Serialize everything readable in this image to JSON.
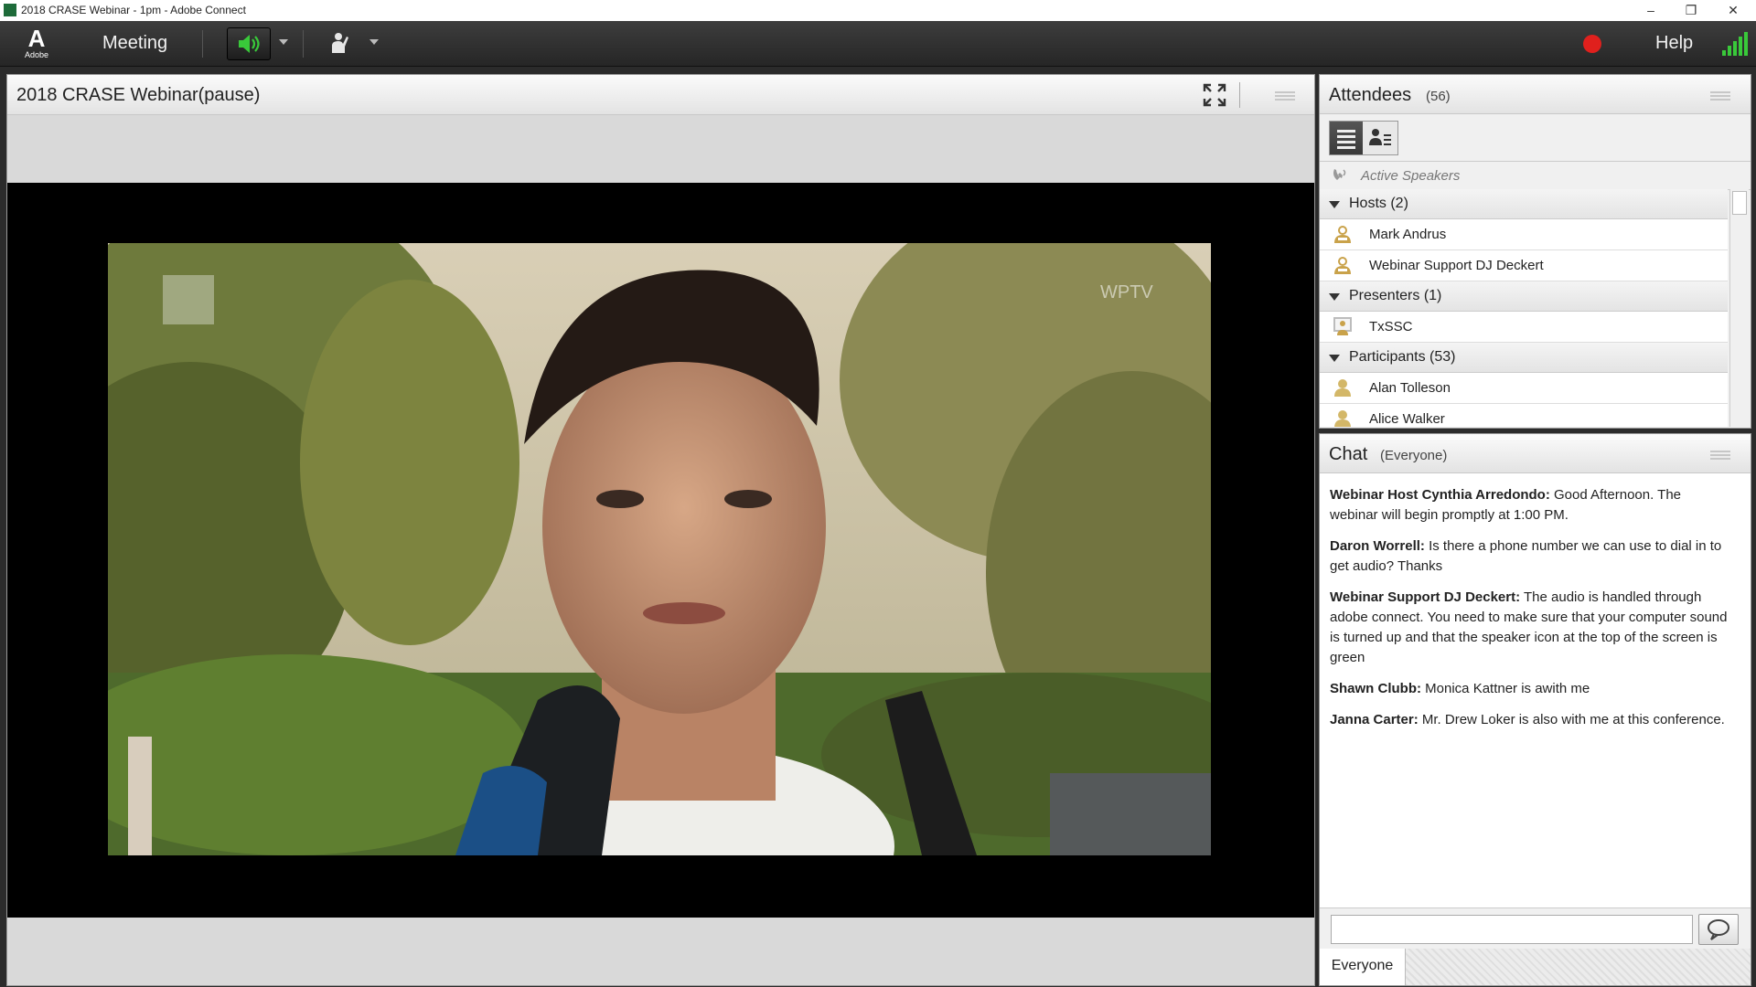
{
  "window": {
    "title": "2018 CRASE Webinar - 1pm - Adobe Connect",
    "min_glyph": "–",
    "restore_glyph": "❐",
    "close_glyph": "✕"
  },
  "menubar": {
    "logo_letter": "A",
    "logo_text": "Adobe",
    "meeting_label": "Meeting",
    "help_label": "Help",
    "speaker_color": "#39c93a",
    "record_color": "#e0201d",
    "signal_color": "#39c93a"
  },
  "video_pod": {
    "title": "2018 CRASE Webinar(pause)",
    "watermark": "WPTV"
  },
  "attendees": {
    "title": "Attendees",
    "count": "(56)",
    "active_speakers": "Active Speakers",
    "groups": [
      {
        "label": "Hosts (2)",
        "members": [
          "Mark Andrus",
          "Webinar Support DJ Deckert"
        ]
      },
      {
        "label": "Presenters (1)",
        "members": [
          "TxSSC"
        ]
      },
      {
        "label": "Participants (53)",
        "members": [
          "Alan Tolleson",
          "Alice Walker"
        ]
      }
    ]
  },
  "chat": {
    "title": "Chat",
    "scope": "(Everyone)",
    "messages": [
      {
        "sender": "Webinar Host Cynthia Arredondo:",
        "text": " Good Afternoon.  The webinar will begin promptly at 1:00 PM."
      },
      {
        "sender": "Daron Worrell:",
        "text": " Is there a phone number we can use to dial in to get audio? Thanks"
      },
      {
        "sender": "Webinar Support DJ Deckert:",
        "text": " The audio is handled through adobe connect. You need to make sure that your computer sound is turned up and that the speaker icon at the top of the screen is green"
      },
      {
        "sender": "Shawn Clubb:",
        "text": " Monica Kattner is awith me"
      },
      {
        "sender": "Janna Carter:",
        "text": " Mr. Drew Loker is also with me at this conference."
      }
    ],
    "input_value": "",
    "tab_label": "Everyone"
  }
}
